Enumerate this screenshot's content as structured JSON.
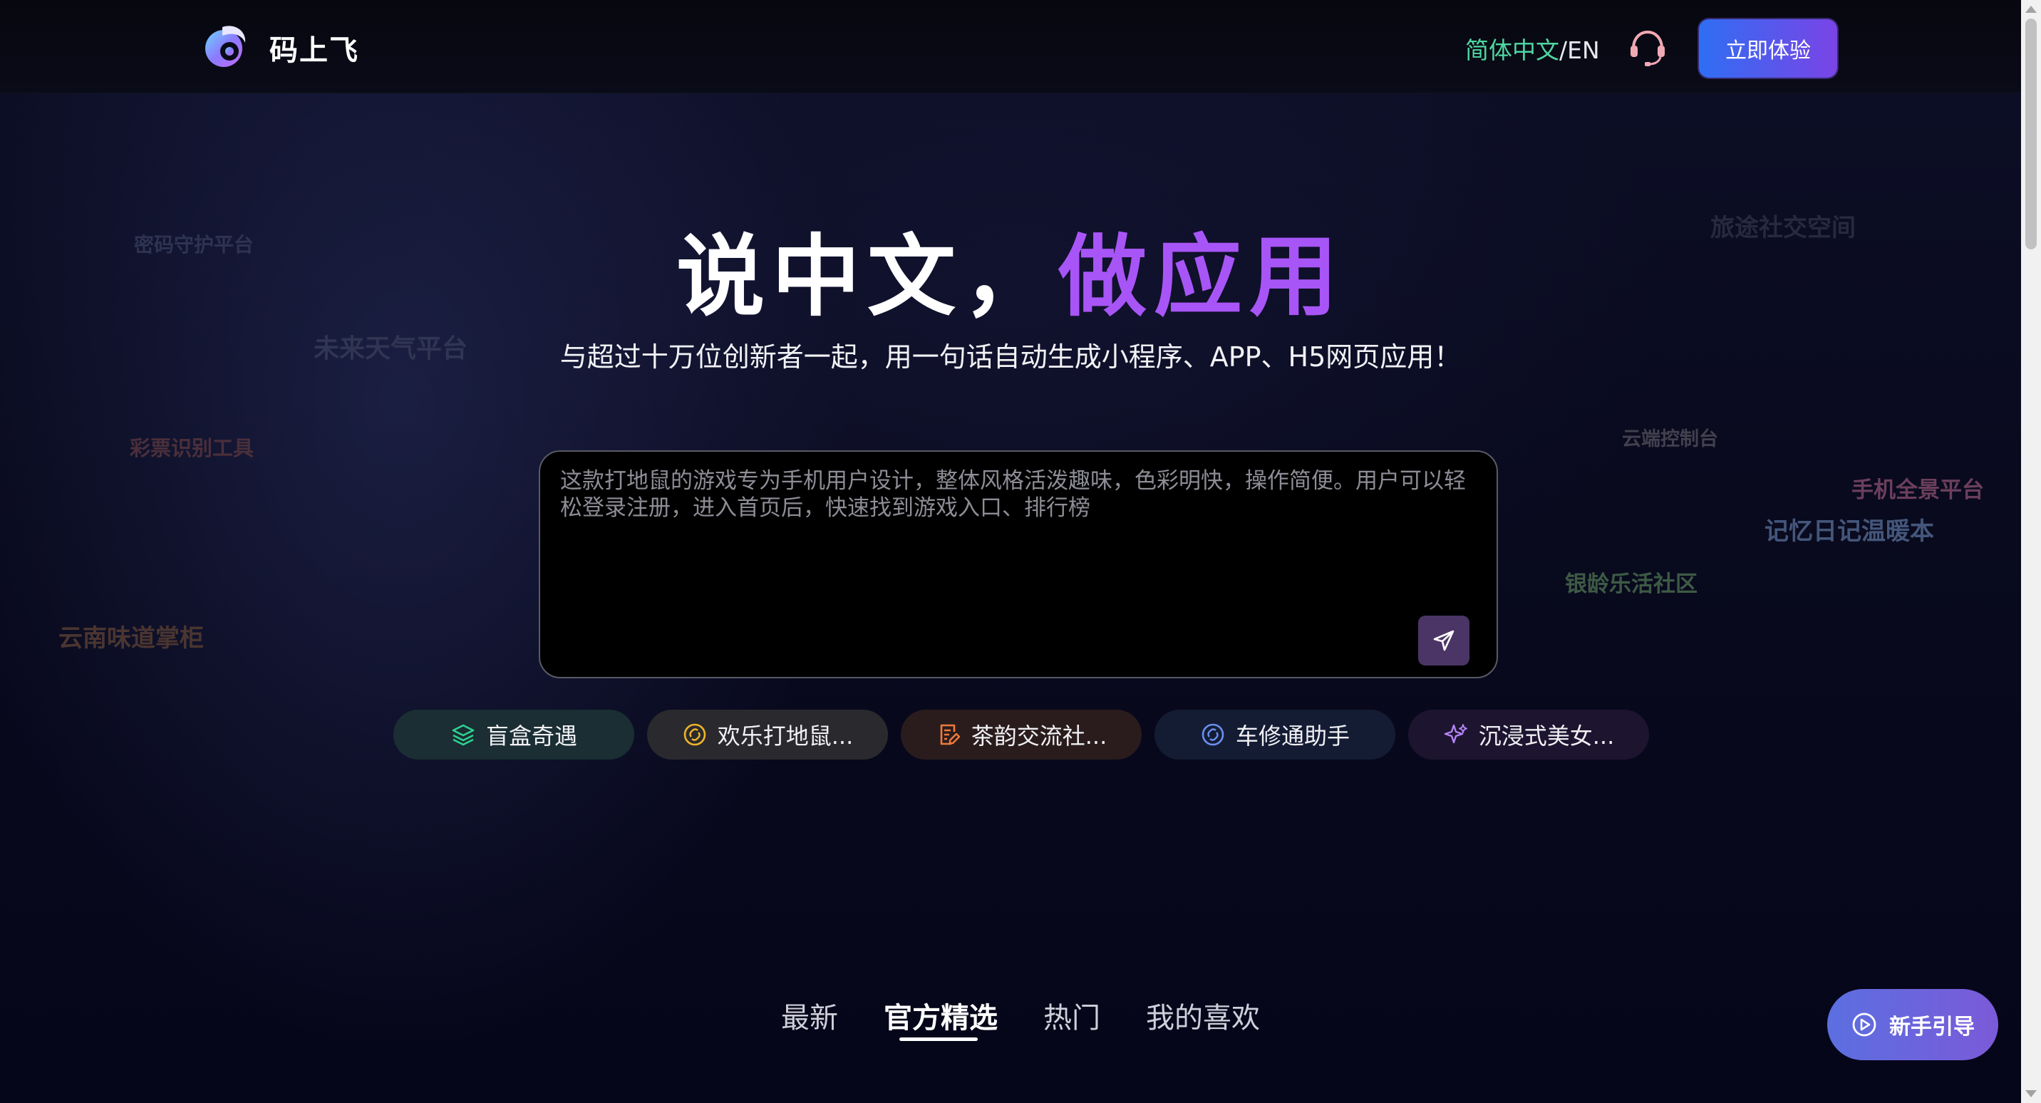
{
  "header": {
    "brand": "码上飞",
    "lang_zh": "简体中文",
    "lang_sep": "/",
    "lang_en": "EN",
    "try_button": "立即体验",
    "support_icon": "headset-icon"
  },
  "floating_words": [
    {
      "text": "密码守护平台",
      "color": "#2e3352"
    },
    {
      "text": "未来天气平台",
      "color": "#2f3552"
    },
    {
      "text": "彩票识别工具",
      "color": "#4a2f3a"
    },
    {
      "text": "云南味道掌柜",
      "color": "#4a3530"
    },
    {
      "text": "旅途社交空间",
      "color": "#262a3f"
    },
    {
      "text": "云端控制台",
      "color": "#43404e"
    },
    {
      "text": "手机全景平台",
      "color": "#6b3f5c"
    },
    {
      "text": "记忆日记温暖本",
      "color": "#44567a"
    },
    {
      "text": "银龄乐活社区",
      "color": "#3d5a45"
    }
  ],
  "hero": {
    "title_main": "说中文，",
    "title_accent": "做应用",
    "subtitle": "与超过十万位创新者一起，用一句话自动生成小程序、APP、H5网页应用！",
    "prompt_placeholder": "这款打地鼠的游戏专为手机用户设计，整体风格活泼趣味，色彩明快，操作简便。用户可以轻松登录注册，进入首页后，快速找到游戏入口、排行榜",
    "send_icon": "send-icon"
  },
  "chips": [
    {
      "label": "盲盒奇遇",
      "icon": "layers-icon",
      "color": "#2fd28e"
    },
    {
      "label": "欢乐打地鼠...",
      "icon": "link-icon",
      "color": "#f0b429"
    },
    {
      "label": "茶韵交流社...",
      "icon": "edit-doc-icon",
      "color": "#f07a3a"
    },
    {
      "label": "车修通助手",
      "icon": "link-icon",
      "color": "#6a8ff0"
    },
    {
      "label": "沉浸式美女...",
      "icon": "sparkle-icon",
      "color": "#b383f5"
    }
  ],
  "tabs": [
    {
      "label": "最新",
      "active": false
    },
    {
      "label": "官方精选",
      "active": true
    },
    {
      "label": "热门",
      "active": false
    },
    {
      "label": "我的喜欢",
      "active": false
    }
  ],
  "guide_button": "新手引导"
}
